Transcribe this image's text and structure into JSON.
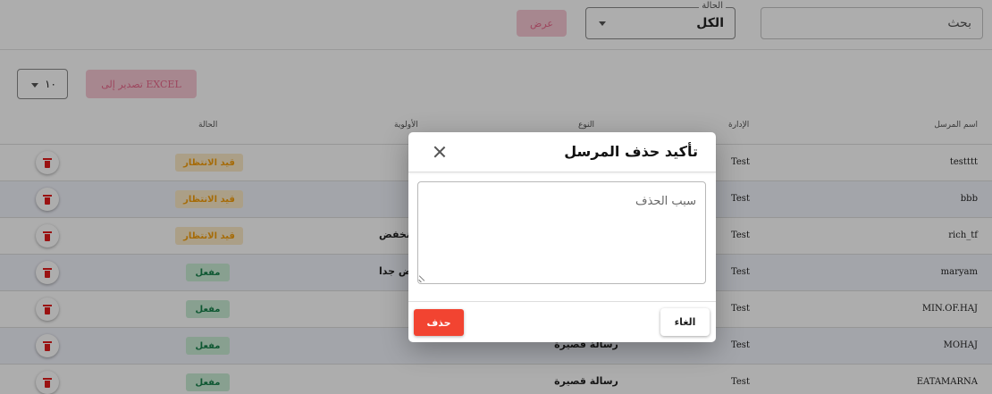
{
  "toolbar": {
    "search_placeholder": "بحث",
    "status_label": "الحالة",
    "status_value": "الكل",
    "view_label": "عرض",
    "page_size": "١٠",
    "export_label": "تصدير إلى EXCEL"
  },
  "table": {
    "headers": {
      "sender_name": "اسم المرسل",
      "department": "الإدارة",
      "type": "النوع",
      "priority": "الأولوية",
      "status": "الحالة"
    },
    "rows": [
      {
        "name": "testttt",
        "department": "Test",
        "type": "",
        "priority": "",
        "status": "قيد الانتظار",
        "status_kind": "pending"
      },
      {
        "name": "bbb",
        "department": "Test",
        "type": "",
        "priority": "",
        "status": "قيد الانتظار",
        "status_kind": "pending"
      },
      {
        "name": "rich_tf",
        "department": "Test",
        "type": "",
        "priority": "منخفض",
        "status": "قيد الانتظار",
        "status_kind": "pending"
      },
      {
        "name": "maryam",
        "department": "Test",
        "type": "",
        "priority": "منخفض جدا",
        "status": "مفعل",
        "status_kind": "active"
      },
      {
        "name": "MIN.OF.HAJ",
        "department": "Test",
        "type": "",
        "priority": "",
        "status": "مفعل",
        "status_kind": "active"
      },
      {
        "name": "MOHAJ",
        "department": "Test",
        "type": "رسالة قصيرة",
        "priority": "",
        "status": "مفعل",
        "status_kind": "active"
      },
      {
        "name": "EATAMARNA",
        "department": "Test",
        "type": "رسالة قصيرة",
        "priority": "",
        "status": "مفعل",
        "status_kind": "active"
      }
    ]
  },
  "modal": {
    "title": "تأكيد حذف المرسل",
    "reason_placeholder": "سبب الحذف",
    "cancel_label": "الغاء",
    "delete_label": "حذف"
  },
  "colors": {
    "accent_pink": "#e8678b",
    "danger": "#f24431",
    "pending": "#f59e0b",
    "active": "#16804a"
  },
  "icons": [
    "trash-icon",
    "close-icon",
    "chevron-down-icon",
    "resize-handle-icon"
  ]
}
